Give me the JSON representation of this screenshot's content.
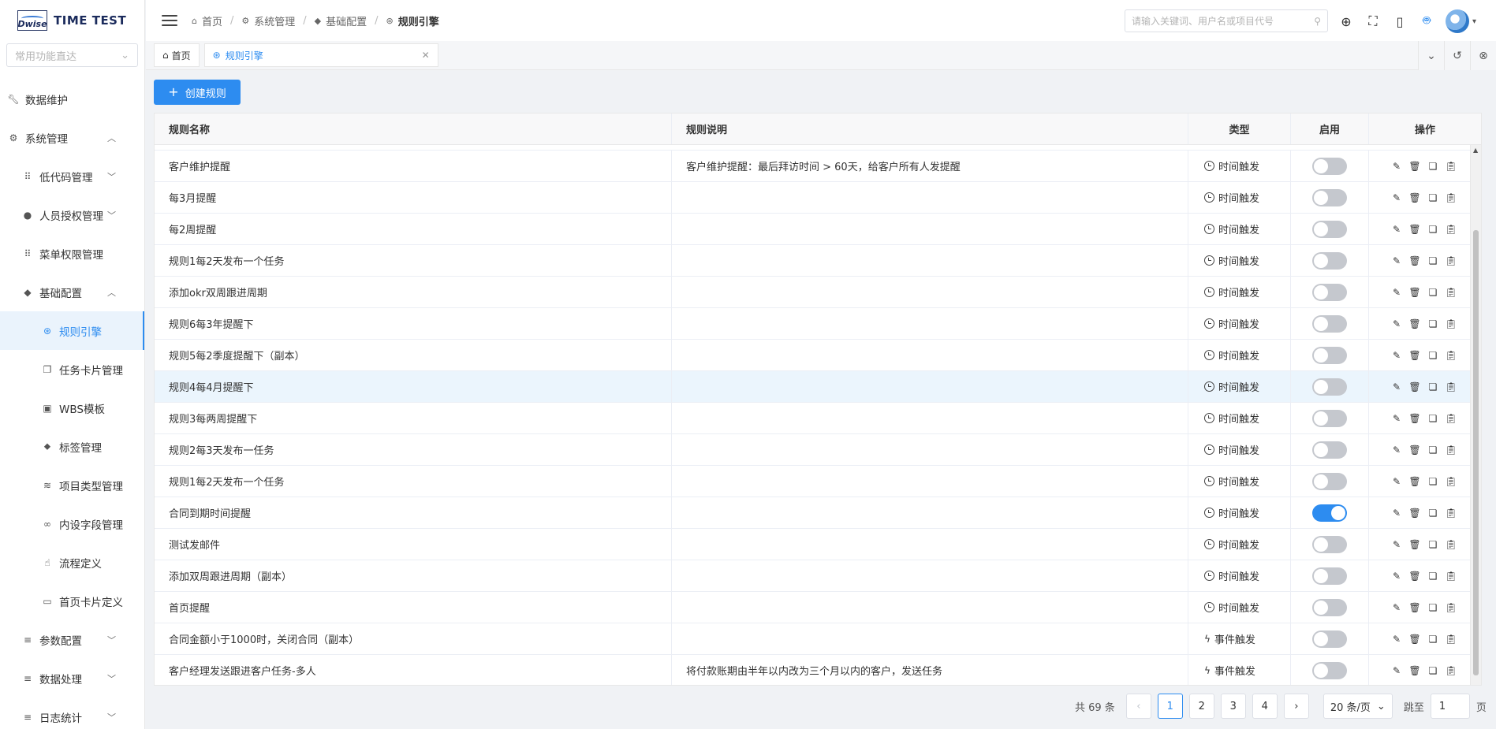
{
  "app": {
    "logo_mark": "Dwise",
    "logo_text": "TIME TEST"
  },
  "sidebar": {
    "quick_select_placeholder": "常用功能直达",
    "items": [
      {
        "label": "数据维护",
        "icon": "wrench-icon"
      },
      {
        "label": "系统管理",
        "icon": "gear-icon"
      },
      {
        "label": "低代码管理",
        "icon": "grid-icon"
      },
      {
        "label": "人员授权管理",
        "icon": "user-icon"
      },
      {
        "label": "菜单权限管理",
        "icon": "grid-icon"
      },
      {
        "label": "基础配置",
        "icon": "cube-icon"
      },
      {
        "label": "规则引擎",
        "icon": "nodes-icon"
      },
      {
        "label": "任务卡片管理",
        "icon": "cards-icon"
      },
      {
        "label": "WBS模板",
        "icon": "printer-icon"
      },
      {
        "label": "标签管理",
        "icon": "tag-icon"
      },
      {
        "label": "项目类型管理",
        "icon": "layers-icon"
      },
      {
        "label": "内设字段管理",
        "icon": "link-icon"
      },
      {
        "label": "流程定义",
        "icon": "thumb-icon"
      },
      {
        "label": "首页卡片定义",
        "icon": "card-icon"
      },
      {
        "label": "参数配置",
        "icon": "filter-icon"
      },
      {
        "label": "数据处理",
        "icon": "filter-icon"
      },
      {
        "label": "日志统计",
        "icon": "filter-icon"
      }
    ]
  },
  "header": {
    "breadcrumb": [
      "首页",
      "系统管理",
      "基础配置",
      "规则引擎"
    ],
    "search_placeholder": "请输入关键词、用户名或项目代号"
  },
  "tabs": [
    {
      "label": "首页"
    },
    {
      "label": "规则引擎"
    }
  ],
  "toolbar": {
    "create_label": "创建规则"
  },
  "table": {
    "columns": [
      "规则名称",
      "规则说明",
      "类型",
      "启用",
      "操作"
    ],
    "rows": [
      {
        "name": "客户维护提醒",
        "desc": "客户维护提醒：最后拜访时间 > 60天，给客户所有人发提醒",
        "type": "时间触发",
        "enabled": false
      },
      {
        "name": "每3月提醒",
        "desc": "",
        "type": "时间触发",
        "enabled": false
      },
      {
        "name": "每2周提醒",
        "desc": "",
        "type": "时间触发",
        "enabled": false
      },
      {
        "name": "规则1每2天发布一个任务",
        "desc": "",
        "type": "时间触发",
        "enabled": false
      },
      {
        "name": "添加okr双周跟进周期",
        "desc": "",
        "type": "时间触发",
        "enabled": false
      },
      {
        "name": "规则6每3年提醒下",
        "desc": "",
        "type": "时间触发",
        "enabled": false
      },
      {
        "name": "规则5每2季度提醒下（副本）",
        "desc": "",
        "type": "时间触发",
        "enabled": false
      },
      {
        "name": "规则4每4月提醒下",
        "desc": "",
        "type": "时间触发",
        "enabled": false
      },
      {
        "name": "规则3每两周提醒下",
        "desc": "",
        "type": "时间触发",
        "enabled": false
      },
      {
        "name": "规则2每3天发布一任务",
        "desc": "",
        "type": "时间触发",
        "enabled": false
      },
      {
        "name": "规则1每2天发布一个任务",
        "desc": "",
        "type": "时间触发",
        "enabled": false
      },
      {
        "name": "合同到期时间提醒",
        "desc": "",
        "type": "时间触发",
        "enabled": true
      },
      {
        "name": "测试发邮件",
        "desc": "",
        "type": "时间触发",
        "enabled": false
      },
      {
        "name": "添加双周跟进周期（副本）",
        "desc": "",
        "type": "时间触发",
        "enabled": false
      },
      {
        "name": "首页提醒",
        "desc": "",
        "type": "时间触发",
        "enabled": false
      },
      {
        "name": "合同金额小于1000时，关闭合同（副本）",
        "desc": "",
        "type": "事件触发",
        "enabled": false
      },
      {
        "name": "客户经理发送跟进客户任务-多人",
        "desc": "将付款账期由半年以内改为三个月以内的客户，发送任务",
        "type": "事件触发",
        "enabled": false
      }
    ],
    "highlight_row": 7
  },
  "pagination": {
    "total_text": "共 69 条",
    "pages": [
      "1",
      "2",
      "3",
      "4"
    ],
    "current": "1",
    "page_size": "20 条/页",
    "jump_label": "跳至",
    "jump_value": "1",
    "page_suffix": "页"
  },
  "colors": {
    "accent": "#2d8cf0",
    "highlight_row": "#ebf5fd"
  }
}
